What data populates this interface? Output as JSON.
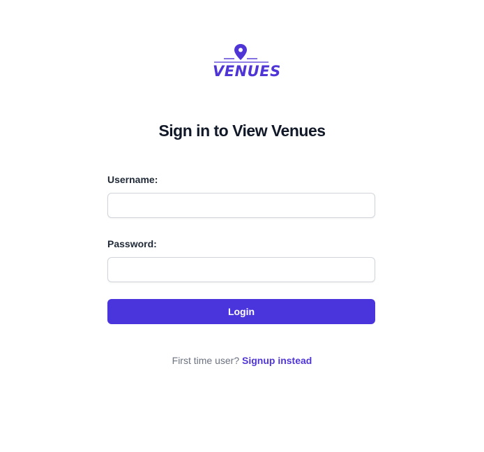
{
  "brand": {
    "logo_text": "VENUES",
    "accent_color": "#4a34dc",
    "icon": "map-pin-icon"
  },
  "form": {
    "title": "Sign in to View Venues",
    "username_label": "Username:",
    "username_value": "",
    "password_label": "Password:",
    "password_value": "",
    "login_label": "Login"
  },
  "footer": {
    "prompt": "First time user?",
    "signup_link": "Signup instead"
  }
}
